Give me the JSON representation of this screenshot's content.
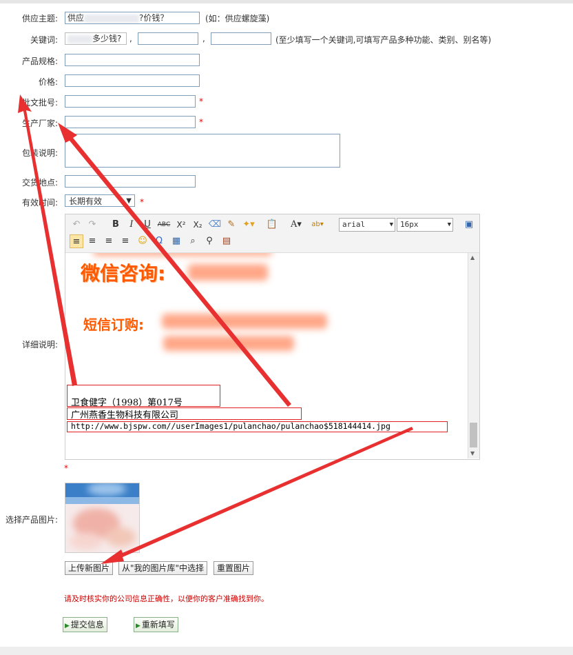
{
  "form": {
    "subject": {
      "label": "供应主题:",
      "value_prefix": "供应",
      "value_suffix": "?价钱？",
      "hint": "(如：供应螺旋藻)"
    },
    "keywords": {
      "label": "关键词:",
      "value_suffix": "多少钱?",
      "sep1": ",",
      "sep2": ",",
      "hint": "(至少填写一个关键词,可填写产品多种功能、类别、别名等)"
    },
    "spec": {
      "label": "产品规格:"
    },
    "price": {
      "label": "价格:"
    },
    "approval": {
      "label": "批文批号:",
      "required": "*"
    },
    "manufacturer": {
      "label": "生产厂家:",
      "required": "*"
    },
    "packaging": {
      "label": "包装说明:"
    },
    "delivery": {
      "label": "交货地点:"
    },
    "validity": {
      "label": "有效时间:",
      "selected": "长期有效",
      "required": "*"
    },
    "detail": {
      "label": "详细说明:",
      "required": "*"
    },
    "image": {
      "label": "选择产品图片:"
    }
  },
  "editor": {
    "font_family": "arial",
    "font_size": "16px",
    "content": {
      "wechat_label": "微信咨询:",
      "sms_label": "短信订购:",
      "line1": "卫食健字（1998）第017号",
      "line2": "广州燕香生物科技有限公司",
      "line3": "http://www.bjspw.com//userImages1/pulanchao/pulanchao$518144414.jpg"
    }
  },
  "buttons": {
    "upload": "上传新图片",
    "from_library": "从\"我的图片库\"中选择",
    "reset_image": "重置图片",
    "submit": "提交信息",
    "refill": "重新填写"
  },
  "notice": "请及时核实你的公司信息正确性，以便你的客户准确找到你。",
  "colors": {
    "required": "#ee0000",
    "annotation": "#e83030",
    "editor_text": "#ff5a00"
  }
}
